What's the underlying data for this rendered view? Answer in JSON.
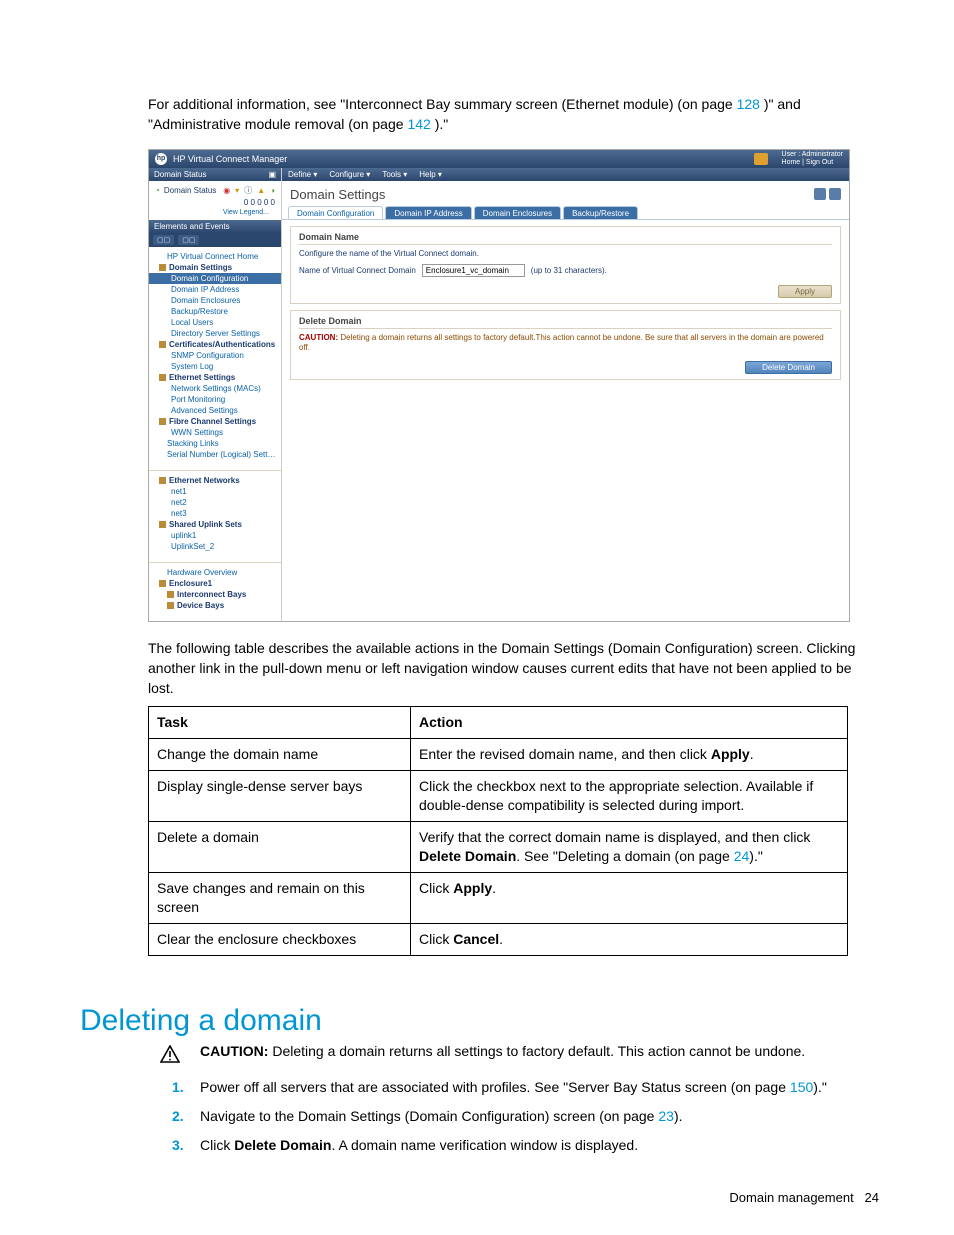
{
  "intro": {
    "t1": "For additional information, see \"Interconnect Bay summary screen (Ethernet module) (on page ",
    "l1": "128",
    "t2": ")\" and \"Administrative module removal (on page ",
    "l2": "142",
    "t3": ").\""
  },
  "vc": {
    "title": "HP Virtual Connect Manager",
    "user_line1": "User : Administrator",
    "user_line2": "Home | Sign Out",
    "menubar": [
      "Define ▾",
      "Configure ▾",
      "Tools ▾",
      "Help ▾"
    ],
    "left_panel1": "Domain Status",
    "status_label": "Domain Status",
    "status_icons_col": "0   0   0   0   0",
    "view_legend": "View Legend...",
    "left_panel2": "Elements and Events",
    "nav": [
      {
        "label": "HP Virtual Connect Home",
        "pad": 18
      },
      {
        "label": "Domain Settings",
        "bold": true
      },
      {
        "label": "Domain Configuration",
        "sel": true,
        "pad": 22
      },
      {
        "label": "Domain IP Address",
        "pad": 22
      },
      {
        "label": "Domain Enclosures",
        "pad": 22
      },
      {
        "label": "Backup/Restore",
        "pad": 22
      },
      {
        "label": "Local Users",
        "pad": 22
      },
      {
        "label": "Directory Server Settings",
        "pad": 22
      },
      {
        "label": "Certificates/Authentications",
        "bold": true
      },
      {
        "label": "SNMP Configuration",
        "pad": 22
      },
      {
        "label": "System Log",
        "pad": 22
      },
      {
        "label": "Ethernet Settings",
        "bold": true
      },
      {
        "label": "Network Settings (MACs)",
        "pad": 22
      },
      {
        "label": "Port Monitoring",
        "pad": 22
      },
      {
        "label": "Advanced Settings",
        "pad": 22
      },
      {
        "label": "Fibre Channel Settings",
        "bold": true
      },
      {
        "label": "WWN Settings",
        "pad": 22
      },
      {
        "label": "Stacking Links",
        "pad": 18
      },
      {
        "label": "Serial Number (Logical) Settings",
        "pad": 18
      }
    ],
    "nav2": [
      {
        "label": "Ethernet Networks",
        "bold": true
      },
      {
        "label": "net1",
        "pad": 22
      },
      {
        "label": "net2",
        "pad": 22
      },
      {
        "label": "net3",
        "pad": 22
      },
      {
        "label": "Shared Uplink Sets",
        "bold": true
      },
      {
        "label": "uplink1",
        "pad": 22
      },
      {
        "label": "UplinkSet_2",
        "pad": 22
      }
    ],
    "nav3": [
      {
        "label": "Hardware Overview",
        "pad": 18
      },
      {
        "label": "Enclosure1",
        "bold": true
      },
      {
        "label": "Interconnect Bays",
        "bold": true,
        "pad": 18
      },
      {
        "label": "Device Bays",
        "bold": true,
        "pad": 18
      }
    ],
    "page_title": "Domain Settings",
    "tabs": [
      "Domain Configuration",
      "Domain IP Address",
      "Domain Enclosures",
      "Backup/Restore"
    ],
    "sec1_title": "Domain Name",
    "sec1_help": "Configure the name of the Virtual Connect domain.",
    "sec1_field": "Name of Virtual Connect Domain",
    "sec1_value": "Enclosure1_vc_domain",
    "sec1_hint": "(up to 31 characters).",
    "apply_btn": "Apply",
    "sec2_title": "Delete Domain",
    "sec2_caution_pre": "CAUTION:",
    "sec2_caution": " Deleting a domain returns all settings to factory default.This action cannot be undone. Be sure that all servers in the domain are powered off.",
    "delete_btn": "Delete Domain"
  },
  "table_intro": "The following table describes the available actions in the Domain Settings (Domain Configuration) screen. Clicking another link in the pull-down menu or left navigation window causes current edits that have not been applied to be lost.",
  "table": {
    "headers": [
      "Task",
      "Action"
    ],
    "rows": [
      {
        "task": "Change the domain name",
        "action_pre": "Enter the revised domain name, and then click ",
        "b1": "Apply",
        "action_post": "."
      },
      {
        "task": "Display single-dense server bays",
        "action": "Click the checkbox next to the appropriate selection. Available if double-dense compatibility is selected during import."
      },
      {
        "task": "Delete a domain",
        "action_pre": "Verify that the correct domain name is displayed, and then click ",
        "b1": "Delete Domain",
        "action_mid": ". See \"Deleting a domain (on page ",
        "link": "24",
        "action_post": ").\""
      },
      {
        "task": "Save changes and remain on this screen",
        "action_pre": "Click ",
        "b1": "Apply",
        "action_post": "."
      },
      {
        "task": "Clear the enclosure checkboxes",
        "action_pre": "Click ",
        "b1": "Cancel",
        "action_post": "."
      }
    ]
  },
  "heading": "Deleting a domain",
  "caution": {
    "bold": "CAUTION:",
    "text": "  Deleting a domain returns all settings to factory default. This action cannot be undone."
  },
  "steps": [
    {
      "pre": "Power off all servers that are associated with profiles. See \"Server Bay Status screen (on page ",
      "link": "150",
      "post": ").\""
    },
    {
      "pre": "Navigate to the Domain Settings (Domain Configuration) screen (on page ",
      "link": "23",
      "post": ")."
    },
    {
      "pre": "Click ",
      "b": "Delete Domain",
      "post": ". A domain name verification window is displayed."
    }
  ],
  "footer": {
    "label": "Domain management",
    "page": "24"
  }
}
